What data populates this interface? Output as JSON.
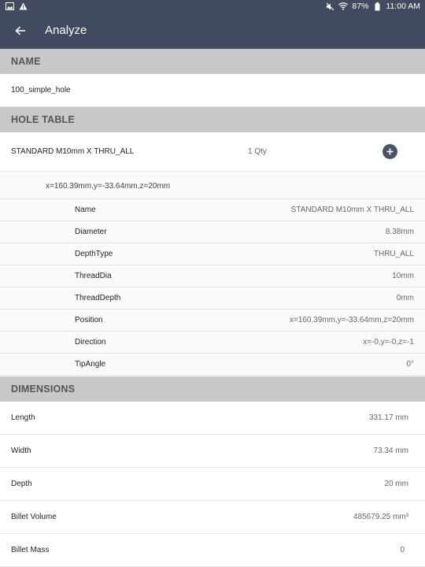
{
  "status_bar": {
    "battery": "87%",
    "time": "11:00 AM"
  },
  "app_bar": {
    "title": "Analyze"
  },
  "name_section": {
    "header": "NAME",
    "value": "100_simple_hole"
  },
  "hole_table": {
    "header": "HOLE TABLE",
    "hole": {
      "title": "STANDARD M10mm X THRU_ALL",
      "qty": "1 Qty",
      "location": "x=160.39mm,y=-33.64mm,z=20mm"
    },
    "properties": [
      {
        "name": "Name",
        "value": "STANDARD M10mm X THRU_ALL"
      },
      {
        "name": "Diameter",
        "value": "8.38mm"
      },
      {
        "name": "DepthType",
        "value": "THRU_ALL"
      },
      {
        "name": "ThreadDia",
        "value": "10mm"
      },
      {
        "name": "ThreadDepth",
        "value": "0mm"
      },
      {
        "name": "Position",
        "value": "x=160.39mm,y=-33.64mm,z=20mm"
      },
      {
        "name": "Direction",
        "value": "x=-0,y=-0,z=-1"
      },
      {
        "name": "TipAngle",
        "value": "0°"
      }
    ]
  },
  "dimensions": {
    "header": "DIMENSIONS",
    "items": [
      {
        "label": "Length",
        "value": "331.17 mm"
      },
      {
        "label": "Width",
        "value": "73.34 mm"
      },
      {
        "label": "Depth",
        "value": "20 mm"
      },
      {
        "label": "Billet Volume",
        "value": "485679.25 mm³"
      },
      {
        "label": "Billet Mass",
        "value": "0"
      }
    ]
  }
}
